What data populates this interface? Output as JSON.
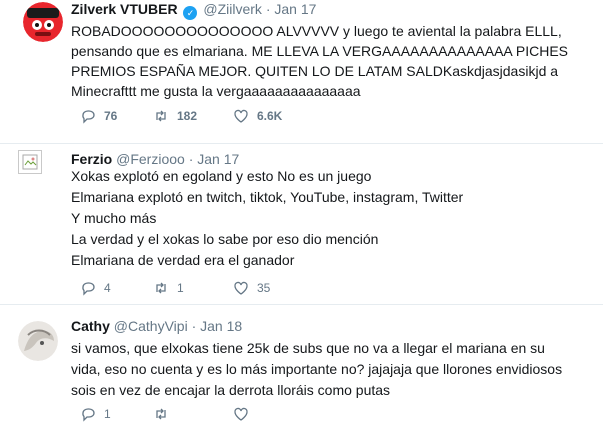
{
  "tweets": [
    {
      "name": "Zilverk VTUBER",
      "verified": true,
      "handle": "@Ziilverk",
      "dot": "·",
      "date": "Jan 17",
      "lines": [
        "ROBADOOOOOOOOOOOOOO ALVVVVV y luego te aviental la palabra ELLL,",
        "pensando que es elmariana. ME LLEVA LA VERGAAAAAAAAAAAAAA PICHES",
        "PREMIOS ESPAÑA MEJOR. QUITEN LO DE LATAM SALDKaskdjasjdasikjd a",
        "Minecrafttt me gusta la vergaaaaaaaaaaaaaaa"
      ],
      "replies": "76",
      "retweets": "182",
      "likes": "6.6K"
    },
    {
      "name": "Ferzio",
      "handle": "@Ferziooo",
      "dot": "·",
      "date": "Jan 17",
      "lines": [
        "Xokas explotó en egoland y esto No es un juego",
        "Elmariana explotó en twitch, tiktok, YouTube, instagram, Twitter",
        "Y mucho más",
        "La verdad y el xokas lo sabe por eso dio mención",
        "Elmariana de verdad era el ganador"
      ],
      "replies": "4",
      "retweets": "1",
      "likes": "35"
    },
    {
      "name": "Cathy",
      "handle": "@CathyVipi",
      "dot": "·",
      "date": "Jan 18",
      "lines": [
        "si vamos, que elxokas tiene 25k de subs que no va a llegar el mariana en su",
        "vida, eso no cuenta y es lo más importante no? jajajaja que llorones envidiosos",
        "sois en vez de encajar la derrota lloráis como putas"
      ],
      "replies": "1",
      "retweets": "",
      "likes": ""
    }
  ],
  "icons": {
    "reply": "reply-icon",
    "retweet": "retweet-icon",
    "like": "heart-icon",
    "verified": "verified-badge-icon"
  },
  "colors": {
    "text": "#14171a",
    "muted": "#657786",
    "verified": "#1da1f2",
    "divider": "#e6ecf0"
  }
}
